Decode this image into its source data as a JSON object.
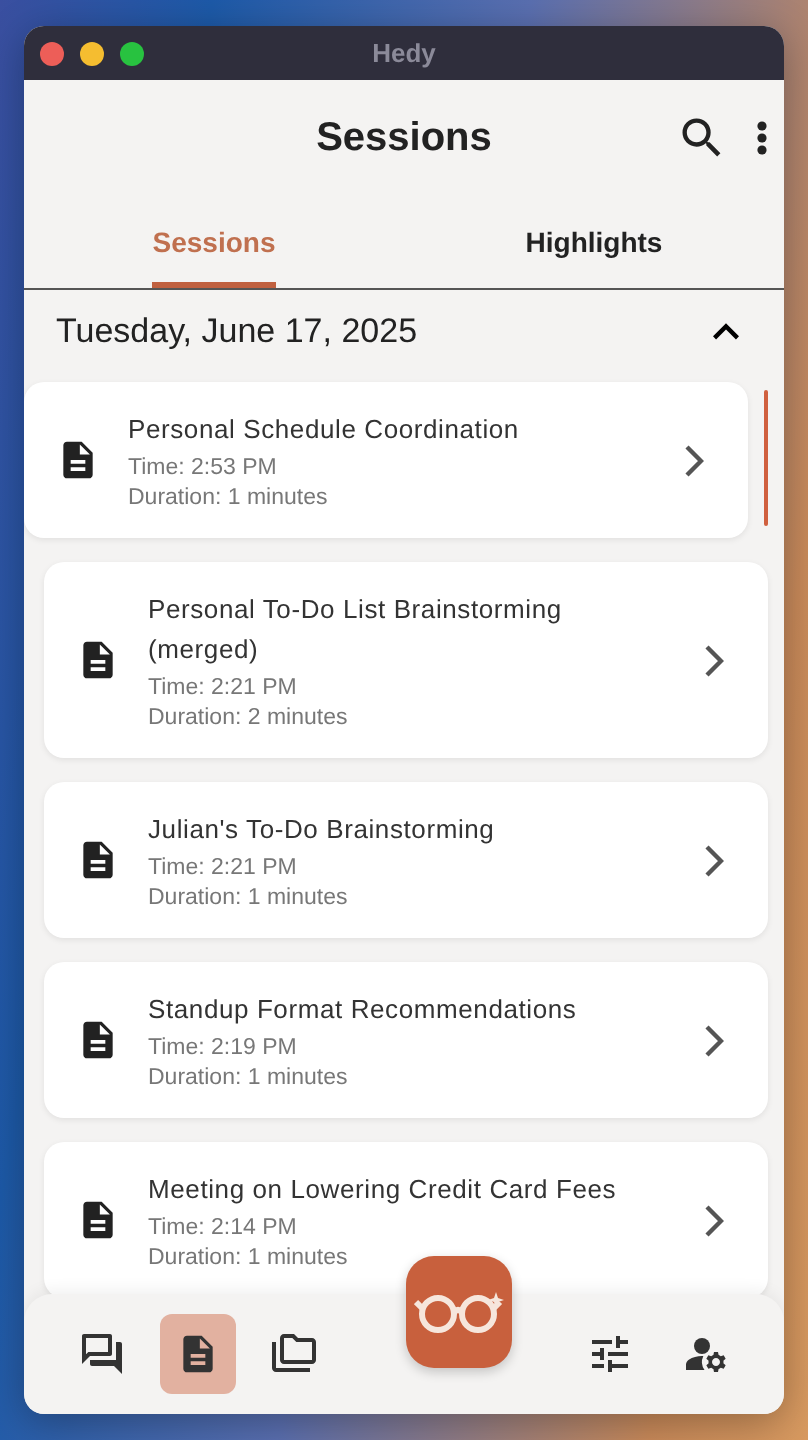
{
  "window": {
    "title": "Hedy"
  },
  "header": {
    "title": "Sessions"
  },
  "tabs": [
    {
      "label": "Sessions",
      "selected": true
    },
    {
      "label": "Highlights",
      "selected": false
    }
  ],
  "date_group": {
    "label": "Tuesday, June 17, 2025",
    "expanded": true
  },
  "sessions": [
    {
      "title": "Personal Schedule Coordination",
      "time": "Time: 2:53 PM",
      "duration": "Duration: 1 minutes",
      "selected": true
    },
    {
      "title": "Personal To-Do List Brainstorming (merged)",
      "time": "Time: 2:21 PM",
      "duration": "Duration: 2 minutes",
      "selected": false
    },
    {
      "title": "Julian's To-Do Brainstorming",
      "time": "Time: 2:21 PM",
      "duration": "Duration: 1 minutes",
      "selected": false
    },
    {
      "title": "Standup Format Recommendations",
      "time": "Time: 2:19 PM",
      "duration": "Duration: 1 minutes",
      "selected": false
    },
    {
      "title": "Meeting on Lowering Credit Card Fees",
      "time": "Time: 2:14 PM",
      "duration": "Duration: 1 minutes",
      "selected": false
    }
  ],
  "nav": [
    {
      "kind": "chats",
      "selected": false
    },
    {
      "kind": "sessions",
      "selected": true
    },
    {
      "kind": "folders",
      "selected": false
    },
    {
      "kind": "assistant",
      "selected": false
    },
    {
      "kind": "settings",
      "selected": false
    },
    {
      "kind": "account",
      "selected": false
    }
  ]
}
